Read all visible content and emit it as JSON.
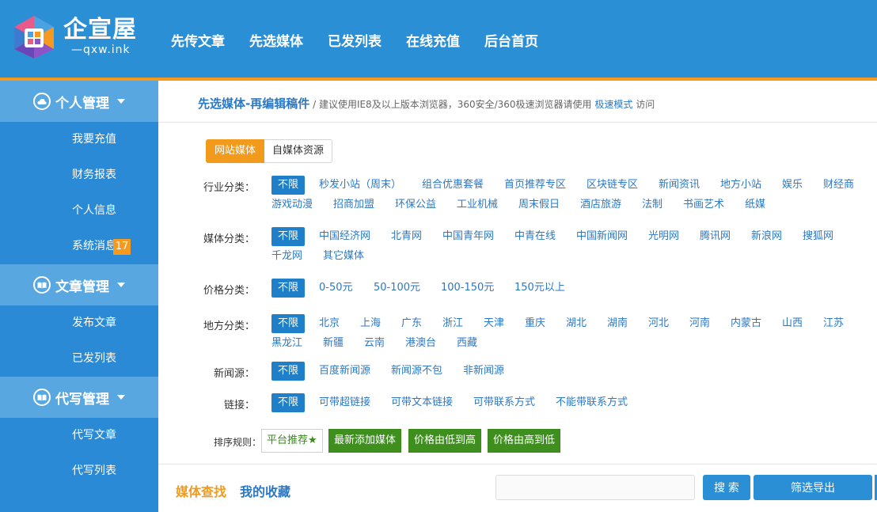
{
  "header": {
    "brand_name": "企宣屋",
    "brand_url": "—qxw.ink",
    "nav": [
      "先传文章",
      "先选媒体",
      "已发列表",
      "在线充值",
      "后台首页"
    ]
  },
  "sidebar": {
    "groups": [
      {
        "title": "个人管理",
        "items": [
          "我要充值",
          "财务报表",
          "个人信息",
          "系统消息"
        ]
      },
      {
        "title": "文章管理",
        "items": [
          "发布文章",
          "已发列表"
        ]
      },
      {
        "title": "代写管理",
        "items": [
          "代写文章",
          "代写列表"
        ]
      }
    ],
    "badge": "17"
  },
  "breadcrumb": {
    "title": "先选媒体-再编辑稿件",
    "sep": "/",
    "hint": "建议使用IE8及以上版本浏览器，360安全/360极速浏览器请使用",
    "link": "极速模式",
    "tail": "访问"
  },
  "tabs": [
    "网站媒体",
    "自媒体资源"
  ],
  "filters": [
    {
      "label": "行业分类：",
      "rows": [
        [
          "不限",
          "秒发小站（周末）",
          "组合优惠套餐",
          "首页推荐专区",
          "区块链专区",
          "新闻资讯",
          "地方小站",
          "娱乐",
          "财经商"
        ],
        [
          "游戏动漫",
          "招商加盟",
          "环保公益",
          "工业机械",
          "周末假日",
          "酒店旅游",
          "法制",
          "书画艺术",
          "纸媒"
        ]
      ]
    },
    {
      "label": "媒体分类：",
      "rows": [
        [
          "不限",
          "中国经济网",
          "北青网",
          "中国青年网",
          "中青在线",
          "中国新闻网",
          "光明网",
          "腾讯网",
          "新浪网",
          "搜狐网"
        ],
        [
          "千龙网",
          "其它媒体"
        ]
      ]
    },
    {
      "label": "价格分类：",
      "rows": [
        [
          "不限",
          "0-50元",
          "50-100元",
          "100-150元",
          "150元以上"
        ]
      ]
    },
    {
      "label": "地方分类：",
      "rows": [
        [
          "不限",
          "北京",
          "上海",
          "广东",
          "浙江",
          "天津",
          "重庆",
          "湖北",
          "湖南",
          "河北",
          "河南",
          "内蒙古",
          "山西",
          "江苏"
        ],
        [
          "黑龙江",
          "新疆",
          "云南",
          "港澳台",
          "西藏"
        ]
      ]
    },
    {
      "label": "新闻源：",
      "rows": [
        [
          "不限",
          "百度新闻源",
          "新闻源不包",
          "非新闻源"
        ]
      ]
    },
    {
      "label": "链接：",
      "rows": [
        [
          "不限",
          "可带超链接",
          "可带文本链接",
          "可带联系方式",
          "不能带联系方式"
        ]
      ]
    }
  ],
  "sort": {
    "label": "排序规则：",
    "options": [
      "平台推荐★",
      "最新添加媒体",
      "价格由低到高",
      "价格由高到低"
    ]
  },
  "bottom": {
    "tab_find": "媒体查找",
    "tab_fav": "我的收藏",
    "search_placeholder": "",
    "search_button": "搜 索",
    "export_button": "筛选导出"
  },
  "colors": {
    "header_bg": "#2b8fd6",
    "accent_orange": "#f29a1c",
    "link_blue": "#2b78c5",
    "selected_blue": "#1f7fc8",
    "sort_green": "#3f8f1f"
  }
}
